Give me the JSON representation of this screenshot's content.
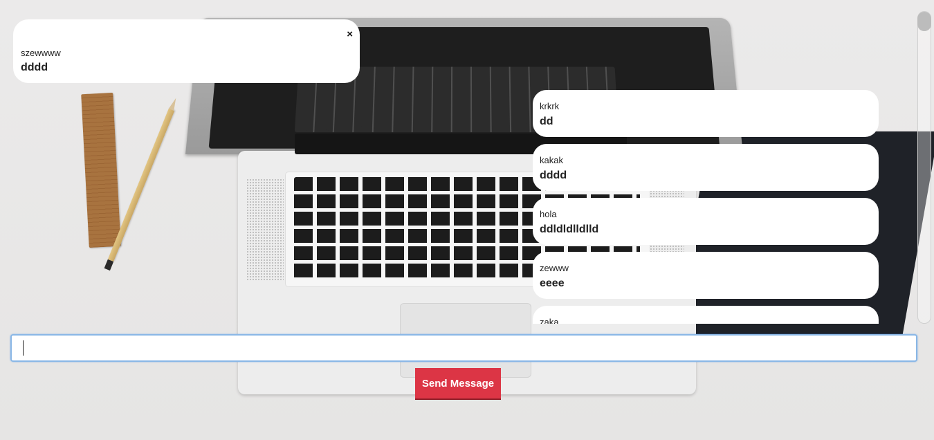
{
  "popup": {
    "close_label": "×",
    "sender": "szewwww",
    "text": "dddd"
  },
  "messages": [
    {
      "sender": "krkrk",
      "text": "dd"
    },
    {
      "sender": "kakak",
      "text": "dddd"
    },
    {
      "sender": "hola",
      "text": "ddldldlldlld"
    },
    {
      "sender": "zewww",
      "text": "eeee"
    },
    {
      "sender": "zaka",
      "text": ""
    }
  ],
  "composer": {
    "input_value": "",
    "send_label": "Send Message"
  },
  "colors": {
    "send_button": "#dc3545",
    "input_focus_border": "#8ab7e6",
    "bubble_bg": "#ffffff"
  }
}
